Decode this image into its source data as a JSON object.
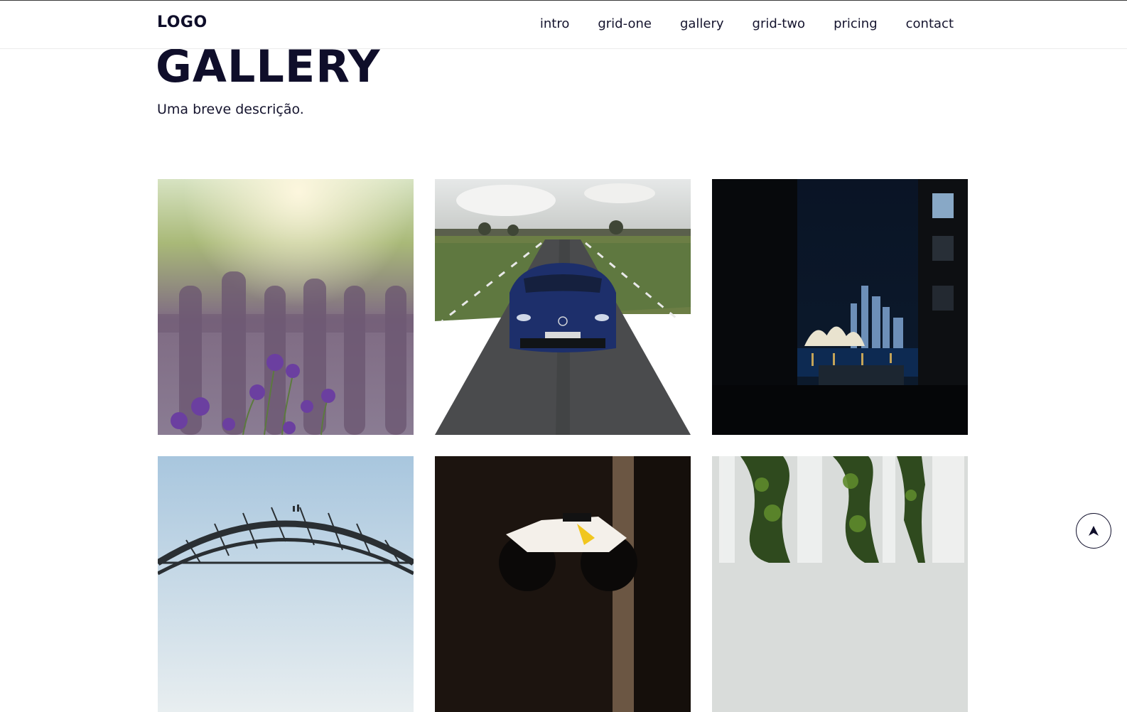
{
  "header": {
    "logo": "LOGO",
    "nav": [
      "intro",
      "grid-one",
      "gallery",
      "grid-two",
      "pricing",
      "contact"
    ]
  },
  "section": {
    "title": "GALLERY",
    "description": "Uma breve descrição."
  },
  "gallery": {
    "images": [
      "purple-flowers-fence",
      "blue-car-road",
      "sydney-opera-house-night",
      "harbour-bridge",
      "motorcycle-dark",
      "waterfall-moss"
    ]
  },
  "back_to_top_icon": "arrow-up-icon"
}
